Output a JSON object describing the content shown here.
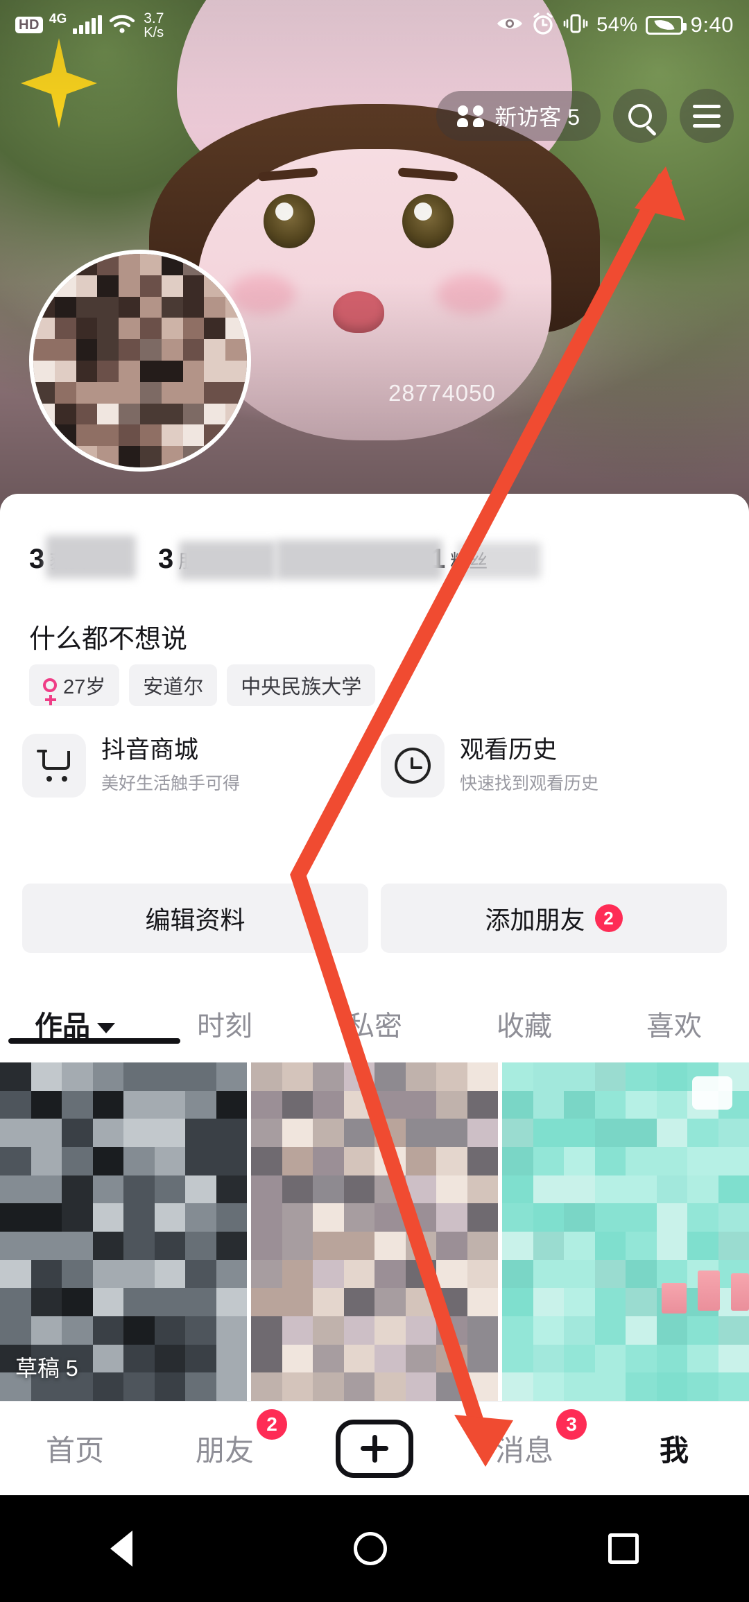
{
  "status_bar": {
    "hd": "HD",
    "network": "4G",
    "net_speed_value": "3.7",
    "net_speed_unit": "K/s",
    "battery_percent": "54%",
    "time": "9:40",
    "icons": [
      "eye-icon",
      "alarm-icon",
      "vibrate-icon",
      "battery-saver-icon"
    ]
  },
  "top_nav": {
    "visitor_label": "新访客 5",
    "search_icon": "search-icon",
    "menu_icon": "hamburger-menu-icon"
  },
  "profile": {
    "user_id": "28774050",
    "stats": [
      {
        "num": "3",
        "label": "获赞"
      },
      {
        "num": "3",
        "label": "朋友"
      },
      {
        "num": "",
        "label": ""
      },
      {
        "num": "1",
        "label": "粉丝"
      }
    ],
    "bio": "什么都不想说",
    "tags": [
      {
        "icon": "venus-icon",
        "label": "27岁"
      },
      {
        "icon": "",
        "label": "安道尔"
      },
      {
        "icon": "",
        "label": "中央民族大学"
      }
    ]
  },
  "entries": [
    {
      "icon": "shopping-cart-icon",
      "title": "抖音商城",
      "subtitle": "美好生活触手可得"
    },
    {
      "icon": "clock-icon",
      "title": "观看历史",
      "subtitle": "快速找到观看历史"
    }
  ],
  "actions": [
    {
      "label": "编辑资料",
      "badge": ""
    },
    {
      "label": "添加朋友",
      "badge": "2"
    }
  ],
  "tabs": [
    {
      "label": "作品",
      "active": true,
      "caret": true
    },
    {
      "label": "时刻",
      "active": false,
      "caret": false
    },
    {
      "label": "私密",
      "active": false,
      "caret": false
    },
    {
      "label": "收藏",
      "active": false,
      "caret": false
    },
    {
      "label": "喜欢",
      "active": false,
      "caret": false
    }
  ],
  "grid": {
    "draft_label": "草稿 5"
  },
  "bottom_nav": [
    {
      "label": "首页",
      "badge": "",
      "active": false
    },
    {
      "label": "朋友",
      "badge": "2",
      "active": false
    },
    {
      "label": "",
      "badge": "",
      "active": false,
      "icon": "plus-icon"
    },
    {
      "label": "消息",
      "badge": "3",
      "active": false
    },
    {
      "label": "我",
      "badge": "",
      "active": true
    }
  ],
  "system_nav": {
    "back": "back-triangle-icon",
    "home": "home-circle-icon",
    "recents": "recents-square-icon"
  },
  "annotation": {
    "color": "#f04b31",
    "description": "红色箭头标注"
  }
}
